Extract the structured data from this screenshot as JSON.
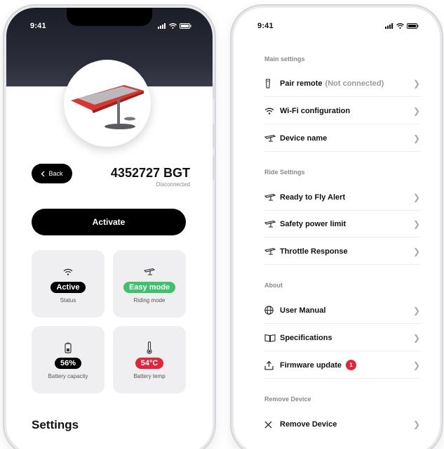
{
  "status_bar": {
    "time": "9:41"
  },
  "device": {
    "back_label": "Back",
    "id": "4352727 BGT",
    "state": "Disconnected",
    "activate_label": "Activate"
  },
  "tiles": [
    {
      "name": "status",
      "pill": "Active",
      "caption": "Status",
      "pill_color": "#000000",
      "icon": "wifi-icon"
    },
    {
      "name": "riding-mode",
      "pill": "Easy mode",
      "caption": "Riding mode",
      "pill_color": "#3cc36a",
      "icon": "foil-board-icon"
    },
    {
      "name": "battery-capacity",
      "pill": "56%",
      "caption": "Battery capacity",
      "pill_color": "#000000",
      "icon": "battery-icon"
    },
    {
      "name": "battery-temp",
      "pill": "54°C",
      "caption": "Battery temp",
      "pill_color": "#e5243b",
      "icon": "thermometer-icon"
    }
  ],
  "left_footer": {
    "settings_title": "Settings"
  },
  "settings": {
    "main": {
      "title": "Main settings",
      "items": [
        {
          "label": "Pair remote",
          "sub": "(Not connected)",
          "icon": "remote-icon"
        },
        {
          "label": "Wi-Fi configuration",
          "icon": "wifi-icon"
        },
        {
          "label": "Device name",
          "icon": "foil-board-icon"
        }
      ]
    },
    "ride": {
      "title": "Ride Settings",
      "items": [
        {
          "label": "Ready to Fly Alert",
          "icon": "foil-board-icon"
        },
        {
          "label": "Safety power limit",
          "icon": "foil-board-icon"
        },
        {
          "label": "Throttle Response",
          "icon": "foil-board-icon"
        }
      ]
    },
    "about": {
      "title": "About",
      "items": [
        {
          "label": "User Manual",
          "icon": "globe-icon"
        },
        {
          "label": "Specifications",
          "icon": "book-icon"
        },
        {
          "label": "Firmware update",
          "badge": "1",
          "icon": "upload-icon"
        }
      ]
    },
    "remove": {
      "title": "Remove Device",
      "items": [
        {
          "label": "Remove Device",
          "icon": "close-icon"
        }
      ]
    }
  },
  "colors": {
    "accent_green": "#3cc36a",
    "alert_red": "#e5243b",
    "tile_bg": "#efeff1"
  }
}
